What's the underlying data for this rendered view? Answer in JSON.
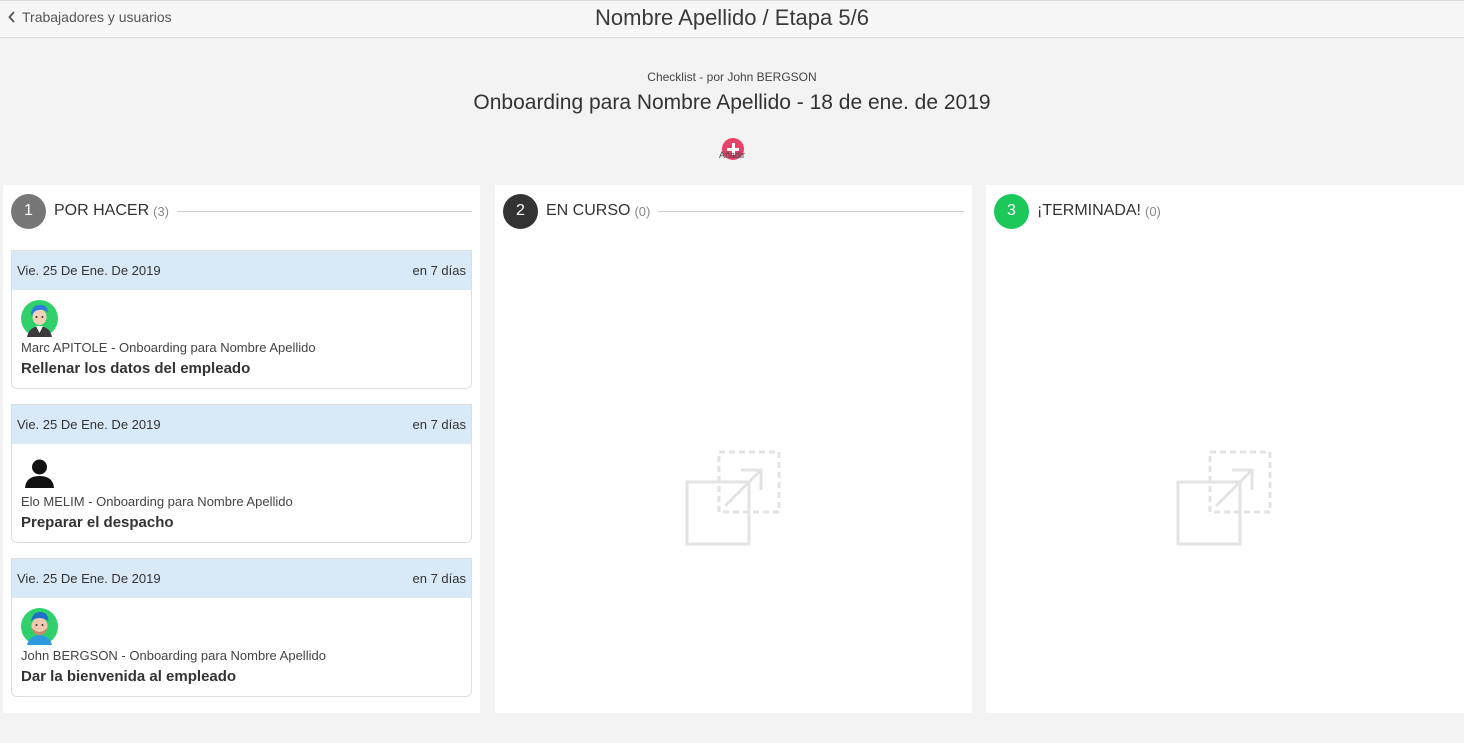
{
  "topbar": {
    "back_label": "Trabajadores y usuarios",
    "title": "Nombre Apellido / Etapa 5/6"
  },
  "checklist": {
    "author": "Checklist - por John BERGSON",
    "title": "Onboarding para Nombre Apellido - 18 de ene. de 2019",
    "add_label": "Añadir"
  },
  "columns": [
    {
      "number": "1",
      "title": "POR HACER",
      "count": "(3)",
      "color": "#777777",
      "tasks": [
        {
          "date": "Vie. 25 De Ene. De 2019",
          "due": "en 7 días",
          "avatar": "avatar-cartoon-man-icon",
          "meta": "Marc APITOLE - Onboarding para Nombre Apellido",
          "name": "Rellenar los datos del empleado"
        },
        {
          "date": "Vie. 25 De Ene. De 2019",
          "due": "en 7 días",
          "avatar": "person-silhouette-icon",
          "meta": "Elo MELIM - Onboarding para Nombre Apellido",
          "name": "Preparar el despacho"
        },
        {
          "date": "Vie. 25 De Ene. De 2019",
          "due": "en 7 días",
          "avatar": "avatar-cartoon-bearded-man-icon",
          "meta": "John BERGSON - Onboarding para Nombre Apellido",
          "name": "Dar la bienvenida al empleado"
        }
      ]
    },
    {
      "number": "2",
      "title": "EN CURSO",
      "count": "(0)",
      "color": "#333333",
      "empty_icon": "drag-drop-placeholder-icon"
    },
    {
      "number": "3",
      "title": "¡TERMINADA!",
      "count": "(0)",
      "color": "#1cc85a",
      "empty_icon": "drag-drop-placeholder-icon"
    }
  ],
  "colors": {
    "accent_pink": "#e8416a",
    "date_bar": "#d8e9f8"
  }
}
